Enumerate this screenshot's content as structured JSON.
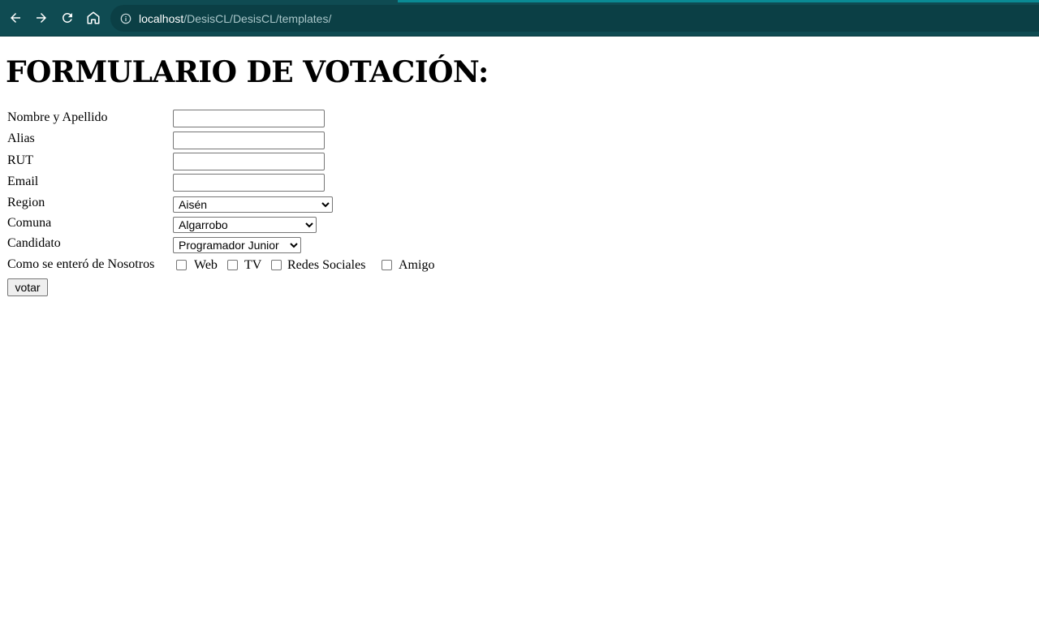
{
  "browser": {
    "url_host": "localhost",
    "url_path": "/DesisCL/DesisCL/templates/"
  },
  "page": {
    "title": "FORMULARIO DE VOTACIÓN:",
    "fields": {
      "nombre_label": "Nombre y Apellido",
      "alias_label": "Alias",
      "rut_label": "RUT",
      "email_label": "Email",
      "region_label": "Region",
      "comuna_label": "Comuna",
      "candidato_label": "Candidato",
      "source_label": "Como se enteró de Nosotros"
    },
    "values": {
      "nombre": "",
      "alias": "",
      "rut": "",
      "email": "",
      "region": "Aisén",
      "comuna": "Algarrobo",
      "candidato": "Programador Junior"
    },
    "checkboxes": [
      "Web",
      "TV",
      "Redes Sociales",
      "Amigo"
    ],
    "submit_label": "votar"
  },
  "colors": {
    "chrome_bg": "#0f4b52",
    "omnibox_bg": "#0b3f45"
  }
}
